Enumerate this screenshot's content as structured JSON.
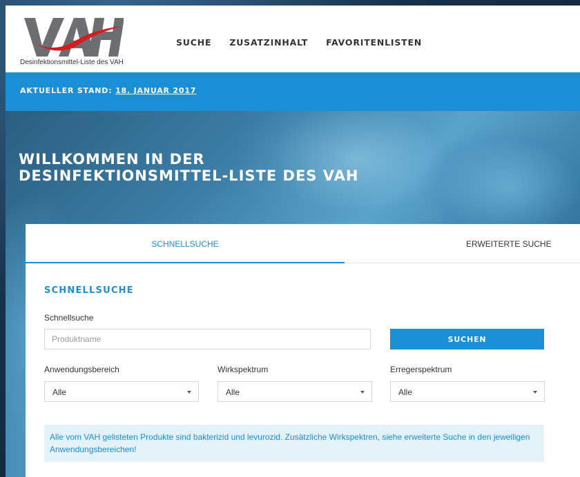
{
  "header": {
    "logo_text": "VAH",
    "logo_subtitle": "Desinfektionsmittel-Liste des VAH",
    "nav": [
      {
        "label": "SUCHE"
      },
      {
        "label": "ZUSATZINHALT"
      },
      {
        "label": "FAVORITENLISTEN"
      }
    ]
  },
  "status": {
    "prefix": "AKTUELLER STAND:",
    "date_link": "18. JANUAR 2017"
  },
  "hero": {
    "title": "WILLKOMMEN IN DER DESINFEKTIONSMITTEL-LISTE DES VAH"
  },
  "tabs": [
    {
      "label": "SCHNELLSUCHE",
      "active": true
    },
    {
      "label": "ERWEITERTE SUCHE",
      "active": false
    }
  ],
  "quick_search": {
    "section_title": "SCHNELLSUCHE",
    "field_label": "Schnellsuche",
    "placeholder": "Produktname",
    "value": "",
    "button_label": "SUCHEN"
  },
  "filters": [
    {
      "label": "Anwendungsbereich",
      "selected": "Alle"
    },
    {
      "label": "Wirkspektrum",
      "selected": "Alle"
    },
    {
      "label": "Erregerspektrum",
      "selected": "Alle"
    }
  ],
  "info": {
    "text": "Alle vom VAH gelisteten Produkte sind bakterizid und levurozid. Zusätzliche Wirkspektren, siehe erweiterte Suche in den jeweiligen Anwendungsbereichen!"
  },
  "colors": {
    "accent": "#1a8fd6",
    "logo_grey": "#6d6e71",
    "logo_red": "#d71920",
    "info_bg": "#e3f1f9"
  }
}
